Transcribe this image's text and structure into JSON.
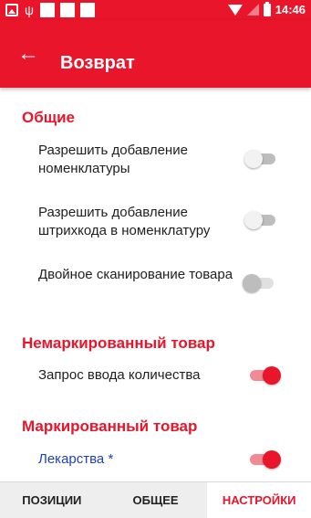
{
  "status_bar": {
    "time": "14:46",
    "icons": [
      "image-icon",
      "usb-icon",
      "notification-square-icon",
      "notification-square-icon",
      "notification-square-icon",
      "wifi-icon",
      "signal-icon",
      "battery-icon"
    ]
  },
  "app_bar": {
    "back_icon": "←",
    "title": "Возврат"
  },
  "sections": [
    {
      "header": "Общие"
    },
    {
      "header": "Немаркированный товар"
    },
    {
      "header": "Маркированный товар"
    }
  ],
  "settings": [
    {
      "label": "Разрешить добавление номенклатуры",
      "state": "off"
    },
    {
      "label": "Разрешить добавление штрихкода в номенклатуру",
      "state": "off"
    },
    {
      "label": "Двойное сканирование товара",
      "state": "off-disabled"
    },
    {
      "label": "Запрос ввода количества",
      "state": "on"
    },
    {
      "label": "Лекарства *",
      "state": "on"
    }
  ],
  "bottom_nav": {
    "tabs": [
      {
        "label": "ПОЗИЦИИ",
        "active": false
      },
      {
        "label": "ОБЩЕЕ",
        "active": false
      },
      {
        "label": "НАСТРОЙКИ",
        "active": true
      }
    ]
  },
  "colors": {
    "accent": "#e8152b",
    "label_blue": "#1e3ec8"
  }
}
